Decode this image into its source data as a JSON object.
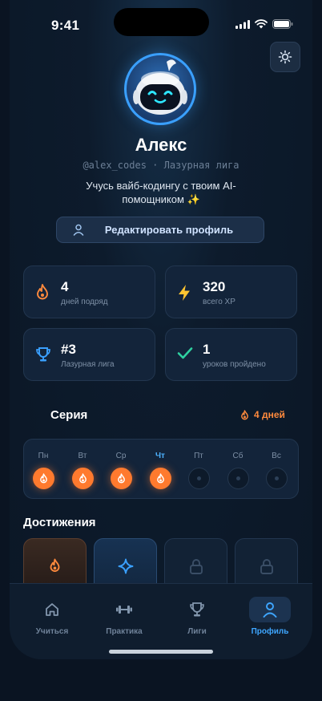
{
  "status_bar": {
    "time": "9:41"
  },
  "profile": {
    "name": "Алекс",
    "handle": "@alex_codes · Лазурная лига",
    "bio": "Учусь вайб-кодингу с твоим AI-помощником ✨",
    "edit_button": "Редактировать профиль"
  },
  "stats": [
    {
      "value": "4",
      "caption": "дней подряд",
      "icon": "flame-icon",
      "color": "#ff8a3d"
    },
    {
      "value": "320",
      "caption": "всего XP",
      "icon": "bolt-icon",
      "color": "#ffc531"
    },
    {
      "value": "#3",
      "caption": "Лазурная лига",
      "icon": "trophy-icon",
      "color": "#3aa0ff"
    },
    {
      "value": "1",
      "caption": "уроков пройдено",
      "icon": "check-icon",
      "color": "#2fd1a0"
    }
  ],
  "streak": {
    "title": "Серия",
    "count": "4 дней",
    "days": [
      {
        "label": "Пн",
        "done": true
      },
      {
        "label": "Вт",
        "done": true
      },
      {
        "label": "Ср",
        "done": true
      },
      {
        "label": "Чт",
        "done": true,
        "today": true
      },
      {
        "label": "Пт",
        "done": false
      },
      {
        "label": "Сб",
        "done": false
      },
      {
        "label": "Вс",
        "done": false
      }
    ]
  },
  "achievements": {
    "title": "Достижения",
    "items": [
      {
        "icon": "flame-icon",
        "unlocked": true
      },
      {
        "icon": "sparkle-icon",
        "unlocked": true
      },
      {
        "icon": "lock-icon",
        "unlocked": false
      },
      {
        "icon": "lock-icon",
        "unlocked": false
      }
    ]
  },
  "tabs": [
    {
      "label": "Учиться",
      "icon": "home-icon",
      "active": false
    },
    {
      "label": "Практика",
      "icon": "dumbbell-icon",
      "active": false
    },
    {
      "label": "Лиги",
      "icon": "trophy-icon",
      "active": false
    },
    {
      "label": "Профиль",
      "icon": "person-icon",
      "active": true
    }
  ],
  "colors": {
    "accent": "#3aa0ff",
    "streak": "#ff7a2e",
    "background": "#0b1726"
  }
}
